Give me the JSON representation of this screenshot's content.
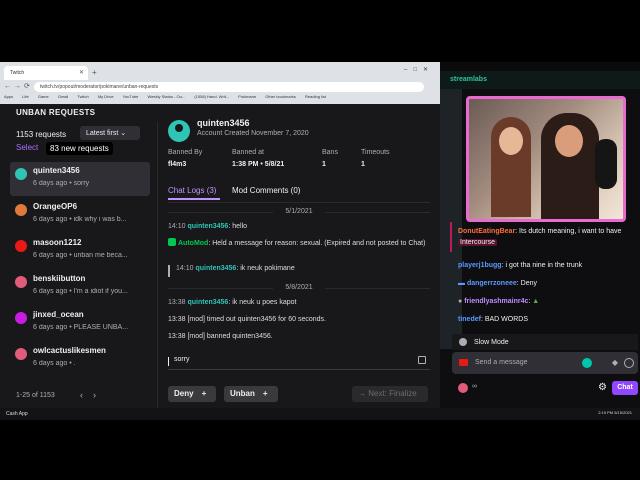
{
  "browser": {
    "tab_title": "Twitch",
    "url": "twitch.tv/popout/moderator/pokimane/unban-requests",
    "bookmarks": [
      "Apps",
      "Life",
      "Game",
      "Gmail",
      "Twitch",
      "My Drive",
      "YouTube",
      "Weekly Status - Ou...",
      "(1558) Hand. Writ...",
      "Pokimane",
      "Other bookmarks",
      "Reading list"
    ]
  },
  "panel": {
    "header": "UNBAN REQUESTS",
    "request_count": "1153 requests",
    "sort_label": "Latest first",
    "select_label": "Select",
    "new_requests_tooltip": "83 new requests",
    "items": [
      {
        "name": "quinten3456",
        "sub": "6 days ago • sorry",
        "color": "#2ec4b6"
      },
      {
        "name": "OrangeOP6",
        "sub": "6 days ago • idk why i was b...",
        "color": "#e07a3c"
      },
      {
        "name": "masoon1212",
        "sub": "6 days ago • unban me beca...",
        "color": "#e91916"
      },
      {
        "name": "benskiibutton",
        "sub": "6 days ago • I'm a idiot if you...",
        "color": "#e05c7a"
      },
      {
        "name": "jinxed_ocean",
        "sub": "6 days ago • PLEASE UNBA...",
        "color": "#c81de0"
      },
      {
        "name": "owlcactuslikesmen",
        "sub": "6 days ago • .",
        "color": "#e05c7a"
      }
    ],
    "pager": "1-25 of 1153",
    "detail": {
      "username": "quinten3456",
      "created": "Account Created November 7, 2020",
      "banned_by_label": "Banned By",
      "banned_by": "fl4m3",
      "banned_at_label": "Banned at",
      "banned_at": "1:38 PM • 5/8/21",
      "bans_label": "Bans",
      "bans": "1",
      "timeouts_label": "Timeouts",
      "timeouts": "1",
      "tab_chat": "Chat Logs (3)",
      "tab_mod": "Mod Comments (0)",
      "date1": "5/1/2021",
      "log1_time": "14:10",
      "log1_user": "quinten3456",
      "log1_text": ": hello",
      "automod_user": "AutoMod",
      "automod_text": ": Held a message for reason: sexual. (Expired and not posted to Chat)",
      "quote_time": "14:10",
      "quote_user": "quinten3456",
      "quote_text": ": ik neuk pokimane",
      "date2": "5/8/2021",
      "log2_time": "13:38",
      "log2_user": "quinten3456",
      "log2_text": ": ik neuk u poes kapot",
      "log3": "13:38 [mod] timed out quinten3456 for 60 seconds.",
      "log4": "13:38 [mod] banned quinten3456.",
      "input_value": "sorry",
      "deny_label": "Deny",
      "unban_label": "Unban",
      "next_label": "Next: Finalize"
    }
  },
  "stream": {
    "brand": "streamlabs",
    "chat": [
      {
        "user": "DonutEatingBear",
        "text": ": Its dutch meaning, i want to have ",
        "highlight": "Intercourse",
        "color": "#ff6d3b"
      },
      {
        "user": "playerj1bugg",
        "text": ": i got tha nine in the trunk",
        "color": "#5b99ff"
      },
      {
        "user": "dangerrzoneee",
        "text": ": Deny",
        "color": "#5b99ff"
      },
      {
        "user": "friendlyashmainr4c",
        "text": ":",
        "color": "#c08bff"
      },
      {
        "user": "tinedef",
        "text": ": BAD WORDS",
        "color": "#5b99ff"
      }
    ],
    "slow_mode": "Slow Mode",
    "send_placeholder": "Send a message",
    "points": "∞",
    "chat_button": "Chat"
  },
  "taskbar": {
    "app": "Cash App",
    "clock": "2:19 PM 5/15/2021"
  }
}
